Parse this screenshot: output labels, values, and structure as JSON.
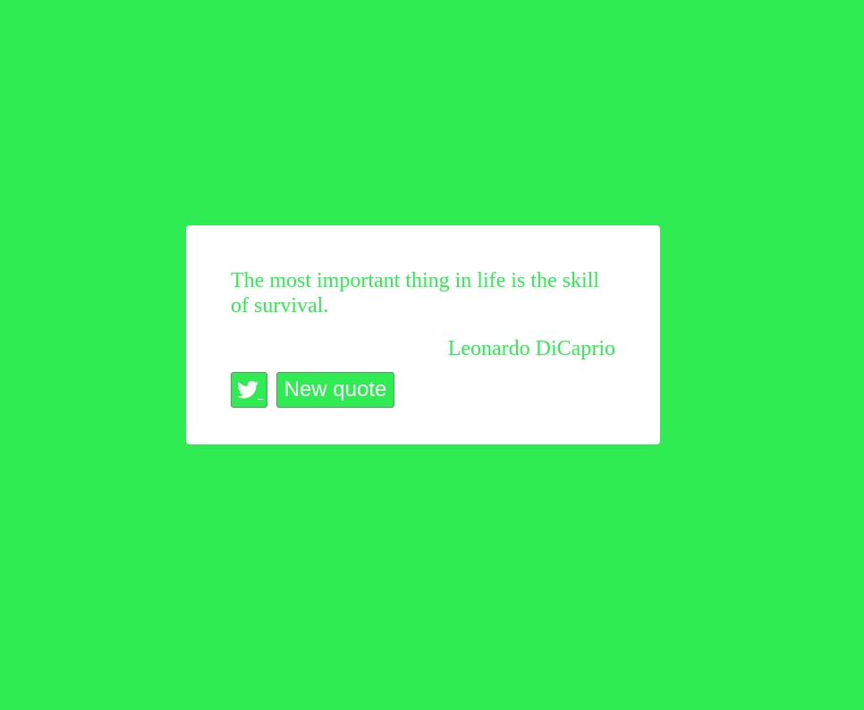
{
  "quote": {
    "text": "The most important thing in life is the skill of survival.",
    "author": "Leonardo DiCaprio"
  },
  "buttons": {
    "tweet_icon": "twitter-bird-icon",
    "new_quote_label": "New quote"
  },
  "colors": {
    "background": "#2fec52",
    "card": "#ffffff",
    "text": "#2fec52",
    "button_text": "#ffffff"
  }
}
